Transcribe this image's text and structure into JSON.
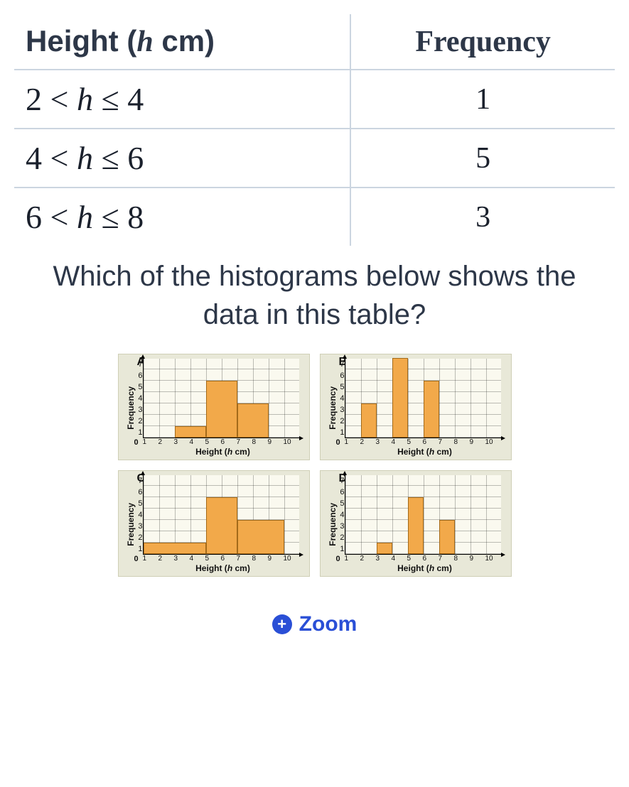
{
  "table": {
    "headers": {
      "height": "Height (h cm)",
      "frequency": "Frequency"
    },
    "rows": [
      {
        "interval": "2 < h ≤ 4",
        "freq": "1"
      },
      {
        "interval": "4 < h ≤ 6",
        "freq": "5"
      },
      {
        "interval": "6 < h ≤ 8",
        "freq": "3"
      }
    ]
  },
  "question": "Which of the histograms below shows the data in this table?",
  "axes": {
    "ylabel": "Frequency",
    "xlabel": "Height (h cm)",
    "yticks": [
      "0",
      "1",
      "2",
      "3",
      "4",
      "5",
      "6",
      "7"
    ],
    "xticks": [
      "0",
      "1",
      "2",
      "3",
      "4",
      "5",
      "6",
      "7",
      "8",
      "9",
      "10"
    ]
  },
  "chart_data": [
    {
      "type": "bar",
      "label": "A",
      "xlabel": "Height (h cm)",
      "ylabel": "Frequency",
      "xlim": [
        0,
        10
      ],
      "ylim": [
        0,
        7
      ],
      "series": [
        {
          "x0": 2,
          "x1": 4,
          "value": 1
        },
        {
          "x0": 4,
          "x1": 6,
          "value": 5
        },
        {
          "x0": 6,
          "x1": 8,
          "value": 3
        }
      ]
    },
    {
      "type": "bar",
      "label": "B",
      "xlabel": "Height (h cm)",
      "ylabel": "Frequency",
      "xlim": [
        0,
        10
      ],
      "ylim": [
        0,
        7
      ],
      "series": [
        {
          "x0": 1,
          "x1": 2,
          "value": 3
        },
        {
          "x0": 3,
          "x1": 4,
          "value": 7
        },
        {
          "x0": 5,
          "x1": 6,
          "value": 5
        }
      ]
    },
    {
      "type": "bar",
      "label": "C",
      "xlabel": "Height (h cm)",
      "ylabel": "Frequency",
      "xlim": [
        0,
        10
      ],
      "ylim": [
        0,
        7
      ],
      "series": [
        {
          "x0": 0,
          "x1": 4,
          "value": 1
        },
        {
          "x0": 4,
          "x1": 6,
          "value": 5
        },
        {
          "x0": 6,
          "x1": 9,
          "value": 3
        }
      ]
    },
    {
      "type": "bar",
      "label": "D",
      "xlabel": "Height (h cm)",
      "ylabel": "Frequency",
      "xlim": [
        0,
        10
      ],
      "ylim": [
        0,
        7
      ],
      "series": [
        {
          "x0": 2,
          "x1": 3,
          "value": 1
        },
        {
          "x0": 4,
          "x1": 5,
          "value": 5
        },
        {
          "x0": 6,
          "x1": 7,
          "value": 3
        }
      ]
    }
  ],
  "zoom": {
    "label": "Zoom"
  }
}
